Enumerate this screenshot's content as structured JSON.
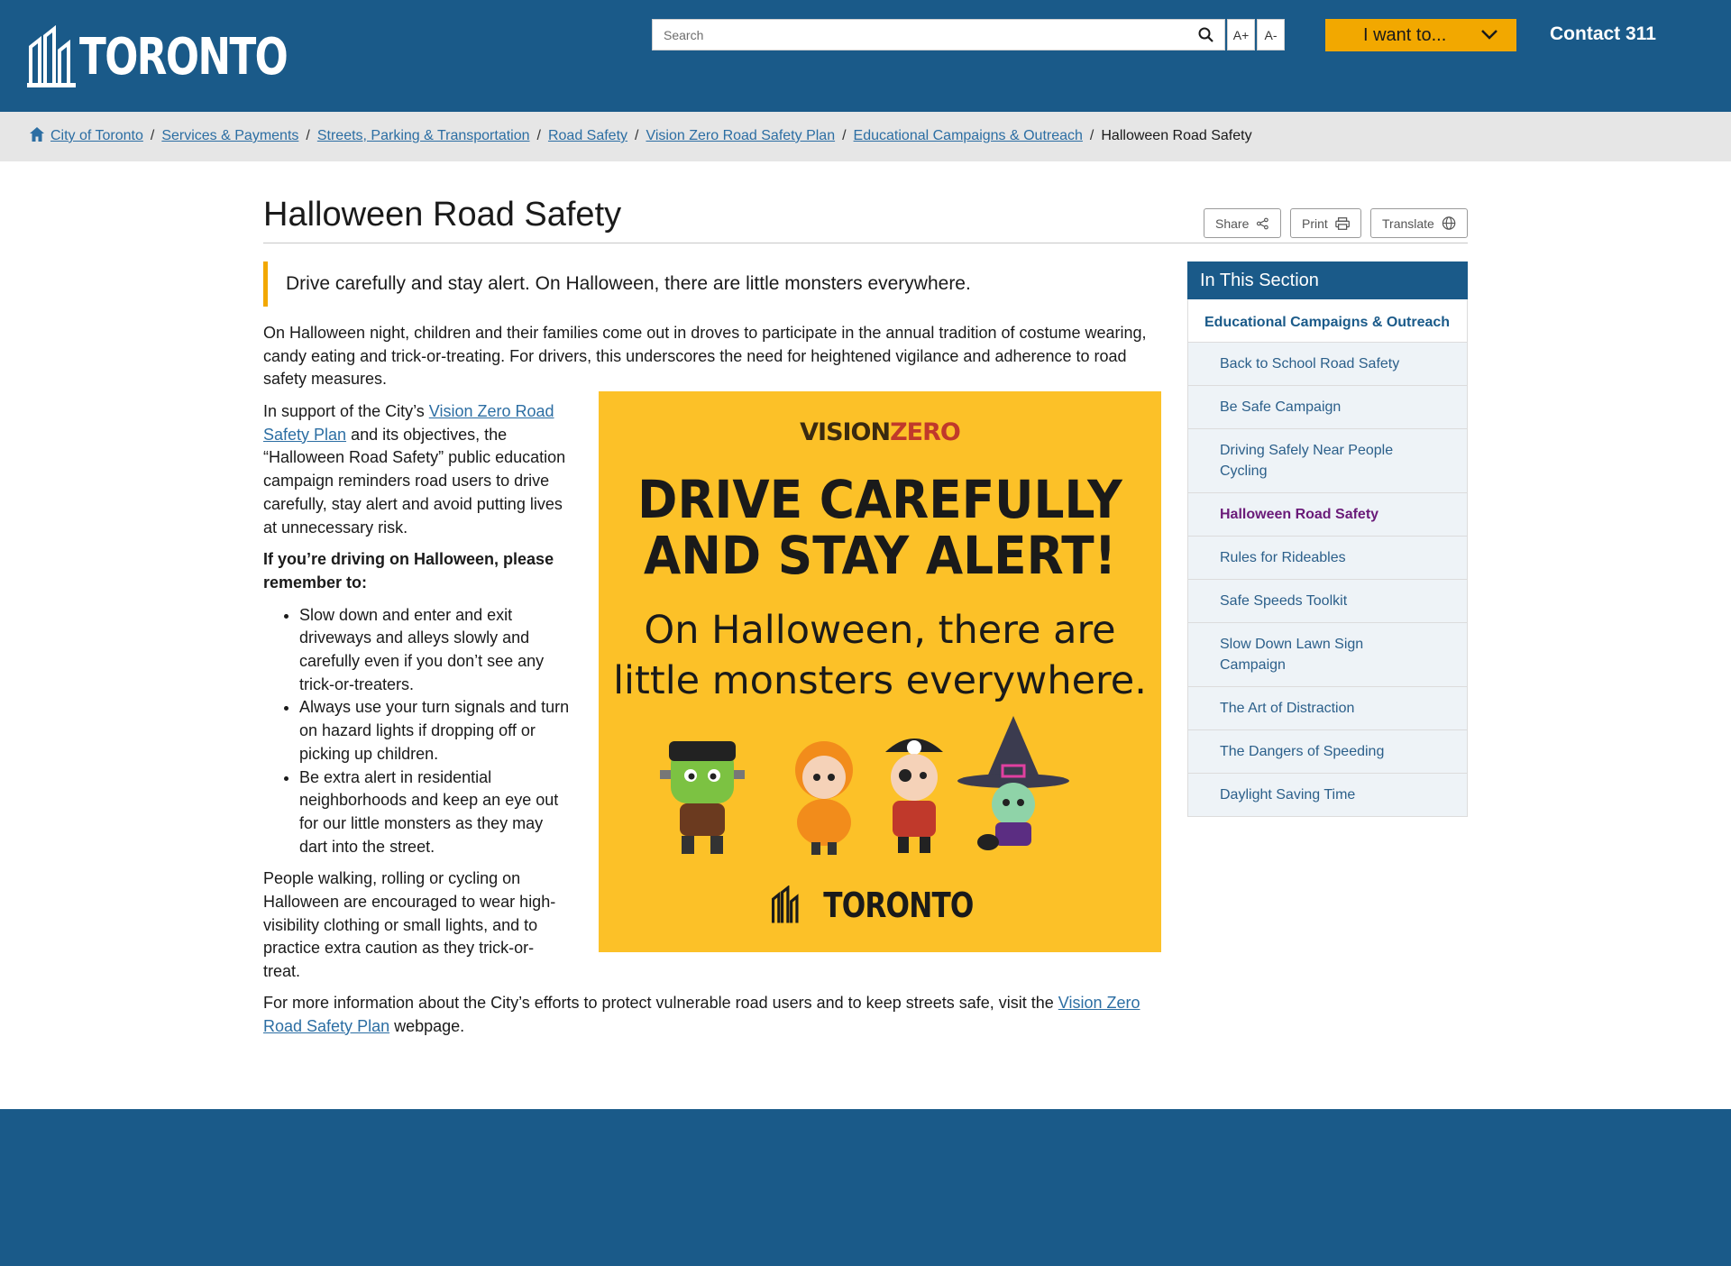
{
  "header": {
    "logo_text": "TORONTO",
    "search_placeholder": "Search",
    "font_increase": "A+",
    "font_decrease": "A-",
    "i_want_to": "I want to...",
    "contact": "Contact 311"
  },
  "breadcrumb": {
    "items": [
      "City of Toronto",
      "Services & Payments",
      "Streets, Parking & Transportation",
      "Road Safety",
      "Vision Zero Road Safety Plan",
      "Educational Campaigns & Outreach"
    ],
    "current": "Halloween Road Safety"
  },
  "page": {
    "title": "Halloween Road Safety",
    "tools": {
      "share": "Share",
      "print": "Print",
      "translate": "Translate"
    },
    "lead": "Drive carefully and stay alert. On Halloween, there are little monsters everywhere.",
    "intro": "On Halloween night, children and their families come out in droves to participate in the annual tradition of costume wearing, candy eating and trick-or-treating. For drivers, this underscores the need for heightened vigilance and adherence to road safety measures.",
    "support_pre": "In support of the City’s ",
    "support_link": "Vision Zero Road Safety Plan",
    "support_post": " and its objectives, the “Halloween Road Safety” public education campaign reminders road users to drive carefully, stay alert and avoid putting lives at unnecessary risk.",
    "driving_heading": "If you’re driving on Halloween, please remember to:",
    "bullets": [
      "Slow down and enter and exit driveways and alleys slowly and carefully even if you don’t see any trick-or-treaters.",
      "Always use your turn signals and turn on hazard lights if dropping off or picking up children.",
      "Be extra alert in residential neighborhoods and keep an eye out for our little monsters as they may dart into the street."
    ],
    "people_text": "People walking, rolling or cycling on Halloween are encouraged to wear high-visibility clothing or small lights, and to practice extra caution as they trick-or-treat.",
    "more_pre": "For more information about the City’s efforts to protect vulnerable road users and to keep streets safe, visit the ",
    "more_link": "Vision Zero Road Safety Plan",
    "more_post": " webpage."
  },
  "campaign_image": {
    "brand_top_a": "VISION",
    "brand_top_b": "ZERO",
    "headline_1": "DRIVE CAREFULLY",
    "headline_2": "AND STAY ALERT!",
    "sub_1": "On Halloween, there are",
    "sub_2": "little monsters everywhere.",
    "brand_bottom": "TORONTO",
    "background_color": "#fcc128"
  },
  "sidebar": {
    "heading": "In This Section",
    "parent": "Educational Campaigns & Outreach",
    "items": [
      "Back to School Road Safety",
      "Be Safe Campaign",
      "Driving Safely Near People Cycling",
      "Halloween Road Safety",
      "Rules for Rideables",
      "Safe Speeds Toolkit",
      "Slow Down Lawn Sign Campaign",
      "The Art of Distraction",
      "The Dangers of Speeding",
      "Daylight Saving Time"
    ],
    "active_index": 3
  },
  "colors": {
    "header_blue": "#1a5a89",
    "accent_orange": "#f2a800",
    "link": "#2c6ea3",
    "active_purple": "#6a1b79"
  }
}
